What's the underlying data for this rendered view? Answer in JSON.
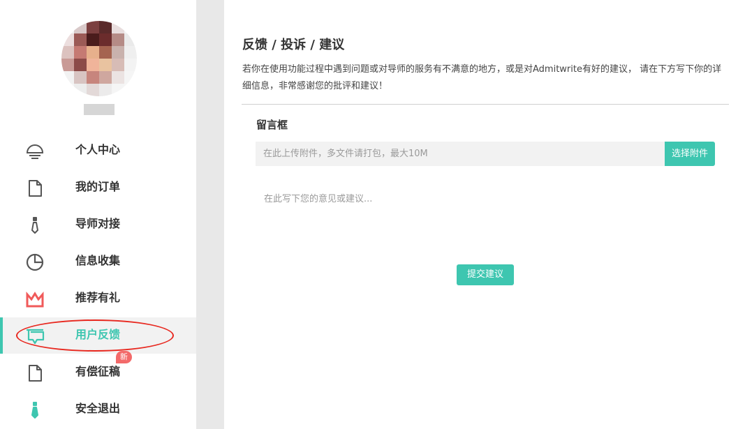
{
  "sidebar": {
    "items": [
      {
        "label": "个人中心",
        "icon": "person-bust-icon"
      },
      {
        "label": "我的订单",
        "icon": "document-icon"
      },
      {
        "label": "导师对接",
        "icon": "tie-icon"
      },
      {
        "label": "信息收集",
        "icon": "pie-chart-icon"
      },
      {
        "label": "推荐有礼",
        "icon": "crown-icon"
      },
      {
        "label": "用户反馈",
        "icon": "chat-bubble-icon",
        "active": true
      },
      {
        "label": "有偿征稿",
        "icon": "document-icon",
        "badge": "新"
      },
      {
        "label": "安全退出",
        "icon": "tie-icon"
      }
    ]
  },
  "main": {
    "title": "反馈 / 投诉 / 建议",
    "description": "若你在使用功能过程中遇到问题或对导师的服务有不满意的地方，或是对Admitwrite有好的建议， 请在下方写下你的详细信息，非常感谢您的批评和建议！",
    "message_box_title": "留言框",
    "upload_placeholder": "在此上传附件，多文件请打包，最大10M",
    "choose_attachment_label": "选择附件",
    "message_placeholder": "在此写下您的意见或建议...",
    "submit_label": "提交建议"
  },
  "colors": {
    "accent": "#3ec6b0",
    "badge": "#f36a6a",
    "highlight": "#e8281f",
    "crown": "#f05a5a"
  }
}
